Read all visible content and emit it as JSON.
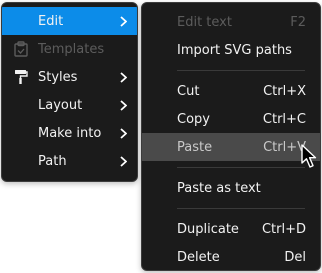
{
  "left_menu": {
    "items": [
      {
        "label": "Edit",
        "active": true,
        "disabled": false,
        "icon": "",
        "has_submenu": true
      },
      {
        "label": "Templates",
        "active": false,
        "disabled": true,
        "icon": "clipboard-icon",
        "has_submenu": false
      },
      {
        "label": "Styles",
        "active": false,
        "disabled": false,
        "icon": "paint-roller-icon",
        "has_submenu": true
      },
      {
        "label": "Layout",
        "active": false,
        "disabled": false,
        "icon": "",
        "has_submenu": true
      },
      {
        "label": "Make into",
        "active": false,
        "disabled": false,
        "icon": "",
        "has_submenu": true
      },
      {
        "label": "Path",
        "active": false,
        "disabled": false,
        "icon": "",
        "has_submenu": true
      }
    ]
  },
  "right_menu": {
    "items": [
      {
        "label": "Edit text",
        "shortcut": "F2",
        "disabled": true
      },
      {
        "label": "Import SVG paths",
        "shortcut": ""
      },
      {
        "label": "Cut",
        "shortcut": "Ctrl+X"
      },
      {
        "label": "Copy",
        "shortcut": "Ctrl+C"
      },
      {
        "label": "Paste",
        "shortcut": "Ctrl+V",
        "hovered": true
      },
      {
        "label": "Paste as text",
        "shortcut": ""
      },
      {
        "label": "Duplicate",
        "shortcut": "Ctrl+D"
      },
      {
        "label": "Delete",
        "shortcut": "Del"
      }
    ]
  },
  "colors": {
    "menu_bg": "#1b1b1b",
    "active_bg": "#0c8ce9",
    "hover_bg": "#4a4a4a",
    "text": "#f2f2f2",
    "disabled_text": "#5c5c5c"
  }
}
